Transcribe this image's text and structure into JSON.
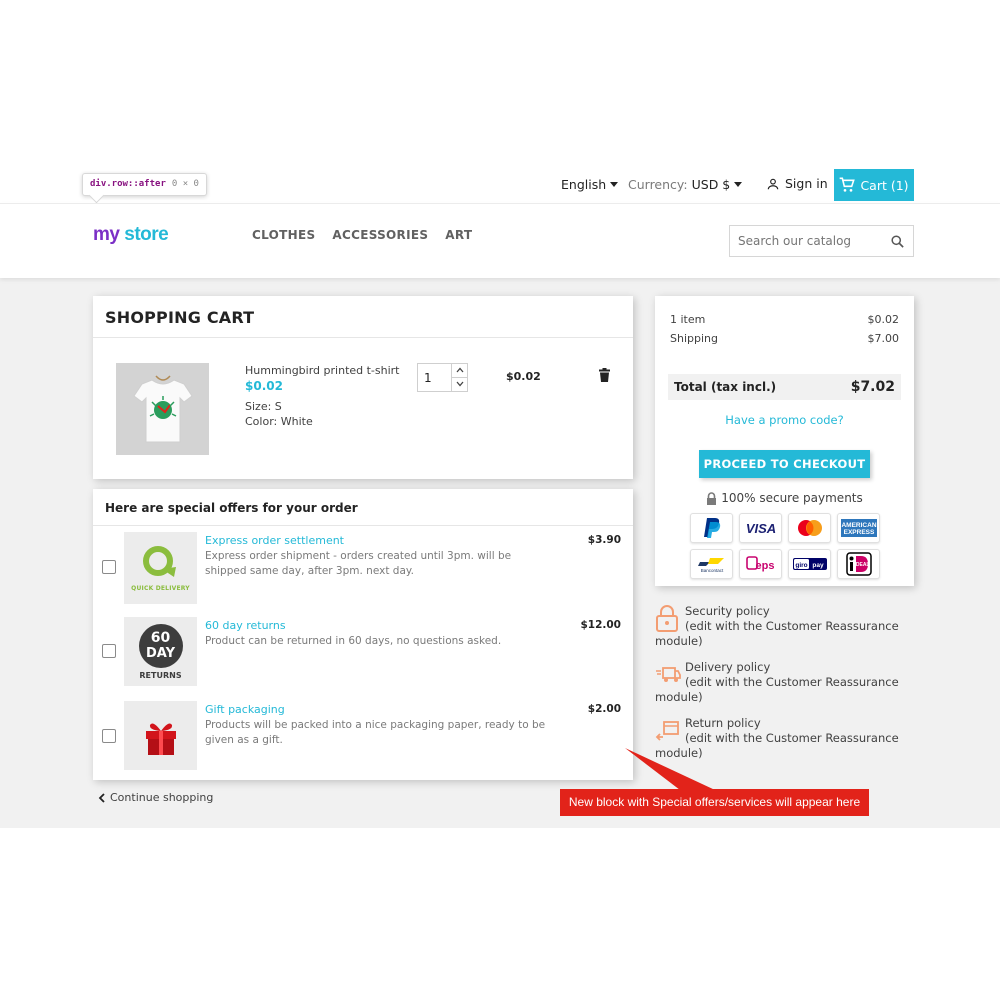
{
  "devtools_tip": {
    "selector": "div.row::after",
    "size": "0 × 0"
  },
  "topnav": {
    "language": "English",
    "currency_label": "Currency:",
    "currency_value": "USD $",
    "sign_in": "Sign in",
    "cart": "Cart (1)"
  },
  "header": {
    "logo": {
      "word1": "my",
      "word2": "store"
    },
    "menu": [
      "CLOTHES",
      "ACCESSORIES",
      "ART"
    ],
    "search_placeholder": "Search our catalog"
  },
  "cart": {
    "title": "SHOPPING CART",
    "item": {
      "name": "Hummingbird printed t-shirt",
      "price": "$0.02",
      "size": "Size: S",
      "color": "Color: White",
      "quantity": "1",
      "line_total": "$0.02"
    }
  },
  "offers": {
    "title": "Here are special offers for your order",
    "items": [
      {
        "title": "Express order settlement",
        "description": "Express order shipment - orders created until 3pm. will be shipped same day, after 3pm. next day.",
        "price": "$3.90",
        "thumb_text": "QUICK DELIVERY"
      },
      {
        "title": "60 day returns",
        "description": "Product can be returned in 60 days, no questions asked.",
        "price": "$12.00",
        "thumb_text_1": "60",
        "thumb_text_2": "DAY",
        "thumb_text_3": "RETURNS"
      },
      {
        "title": "Gift packaging",
        "description": "Products will be packed into a nice packaging paper, ready to be given as a gift.",
        "price": "$2.00"
      }
    ]
  },
  "continue_shopping": "Continue shopping",
  "callout": "New block with Special offers/services will appear here",
  "summary": {
    "items_label": "1 item",
    "items_value": "$0.02",
    "shipping_label": "Shipping",
    "shipping_value": "$7.00",
    "total_label": "Total (tax incl.)",
    "total_value": "$7.02",
    "promo": "Have a promo code?",
    "checkout": "PROCEED TO CHECKOUT",
    "secure": "100% secure payments",
    "payment_methods": [
      "paypal",
      "visa",
      "mastercard",
      "amex",
      "bancontact",
      "eps",
      "giropay",
      "ideal"
    ]
  },
  "reassurance": [
    {
      "title": "Security policy",
      "desc_1": "(edit with the Customer Reassurance",
      "desc_2": "module)"
    },
    {
      "title": "Delivery policy",
      "desc_1": "(edit with the Customer Reassurance",
      "desc_2": "module)"
    },
    {
      "title": "Return policy",
      "desc_1": "(edit with the Customer Reassurance",
      "desc_2": "module)"
    }
  ],
  "colors": {
    "accent": "#24b9d7",
    "callout": "#e2231a",
    "background": "#f1f1f1"
  }
}
